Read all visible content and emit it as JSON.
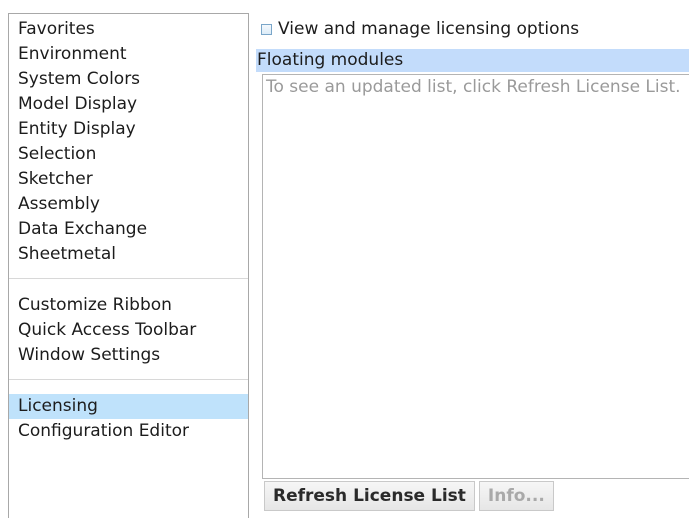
{
  "sidebar": {
    "group1": [
      {
        "label": "Favorites"
      },
      {
        "label": "Environment"
      },
      {
        "label": "System Colors"
      },
      {
        "label": "Model Display"
      },
      {
        "label": "Entity Display"
      },
      {
        "label": "Selection"
      },
      {
        "label": "Sketcher"
      },
      {
        "label": "Assembly"
      },
      {
        "label": "Data Exchange"
      },
      {
        "label": "Sheetmetal"
      }
    ],
    "group2": [
      {
        "label": "Customize Ribbon"
      },
      {
        "label": "Quick Access Toolbar"
      },
      {
        "label": "Window Settings"
      }
    ],
    "group3": [
      {
        "label": "Licensing",
        "selected": true
      },
      {
        "label": "Configuration Editor"
      }
    ]
  },
  "panel": {
    "option_label": "View and manage licensing options",
    "section_title": "Floating modules",
    "list_hint": "To see an updated list, click Refresh License List.",
    "refresh_label": "Refresh License List",
    "info_label": "Info..."
  },
  "colors": {
    "selected_item": "#bfe2fb",
    "section_header": "#c3dcfb",
    "hint_text": "#9a9a9a"
  }
}
